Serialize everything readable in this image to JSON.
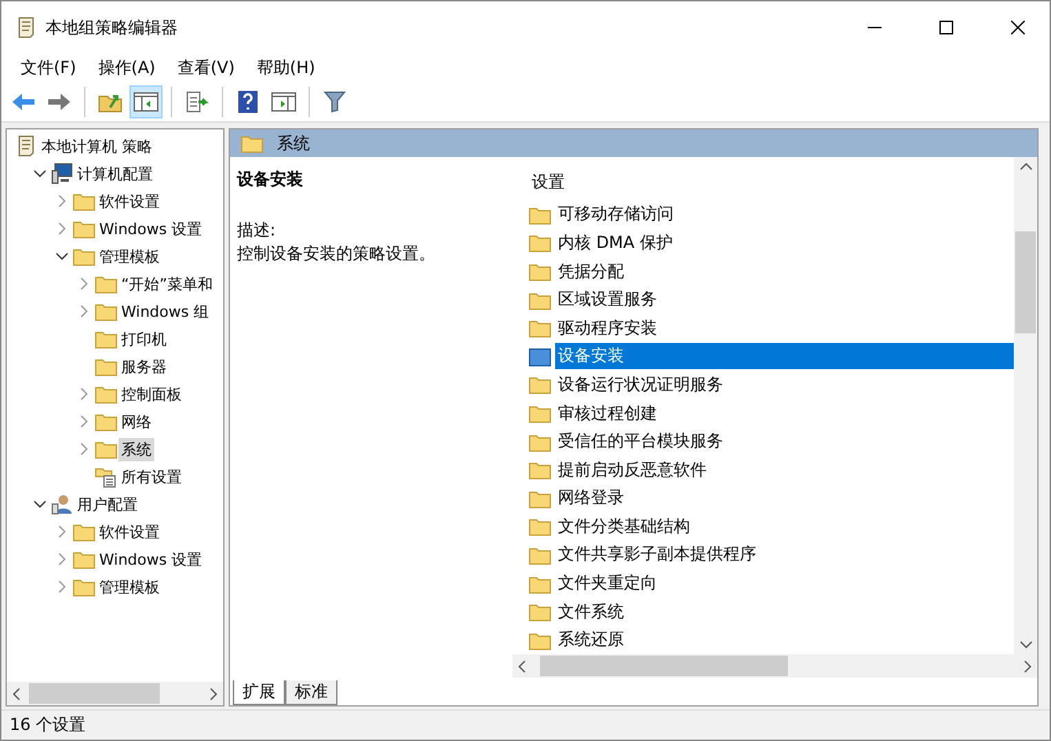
{
  "window": {
    "title": "本地组策略编辑器"
  },
  "menu": [
    "文件(F)",
    "操作(A)",
    "查看(V)",
    "帮助(H)"
  ],
  "toolbar": [
    [
      {
        "kind": "back",
        "pressed": false
      },
      {
        "kind": "forward",
        "pressed": false
      }
    ],
    [
      {
        "kind": "up",
        "pressed": false
      },
      {
        "kind": "tree",
        "pressed": true
      }
    ],
    [
      {
        "kind": "export",
        "pressed": false
      }
    ],
    [
      {
        "kind": "help",
        "pressed": false
      },
      {
        "kind": "panel",
        "pressed": false
      }
    ],
    [
      {
        "kind": "filter",
        "pressed": false
      }
    ]
  ],
  "tree": {
    "label": "本地计算机 策略",
    "kind": "policy",
    "selected": false,
    "children": [
      {
        "label": "计算机配置",
        "kind": "computer",
        "expandable": true,
        "expanded": true,
        "selected": false,
        "children": [
          {
            "label": "软件设置",
            "kind": "folder",
            "expandable": true,
            "expanded": false,
            "selected": false
          },
          {
            "label": "Windows 设置",
            "kind": "folder",
            "expandable": true,
            "expanded": false,
            "selected": false
          },
          {
            "label": "管理模板",
            "kind": "folder",
            "expandable": true,
            "expanded": true,
            "selected": false,
            "children": [
              {
                "label": "“开始”菜单和",
                "kind": "folder",
                "expandable": true,
                "expanded": false,
                "selected": false
              },
              {
                "label": "Windows 组",
                "kind": "folder",
                "expandable": true,
                "expanded": false,
                "selected": false
              },
              {
                "label": "打印机",
                "kind": "folder",
                "expandable": false,
                "selected": false
              },
              {
                "label": "服务器",
                "kind": "folder",
                "expandable": false,
                "selected": false
              },
              {
                "label": "控制面板",
                "kind": "folder",
                "expandable": true,
                "expanded": false,
                "selected": false
              },
              {
                "label": "网络",
                "kind": "folder",
                "expandable": true,
                "expanded": false,
                "selected": false
              },
              {
                "label": "系统",
                "kind": "folder",
                "expandable": true,
                "expanded": false,
                "selected": true
              },
              {
                "label": "所有设置",
                "kind": "settings",
                "expandable": false,
                "selected": false
              }
            ]
          }
        ]
      },
      {
        "label": "用户配置",
        "kind": "user",
        "expandable": true,
        "expanded": true,
        "selected": false,
        "children": [
          {
            "label": "软件设置",
            "kind": "folder",
            "expandable": true,
            "expanded": false,
            "selected": false
          },
          {
            "label": "Windows 设置",
            "kind": "folder",
            "expandable": true,
            "expanded": false,
            "selected": false
          },
          {
            "label": "管理模板",
            "kind": "folder",
            "expandable": true,
            "expanded": false,
            "selected": false
          }
        ]
      }
    ]
  },
  "pane_header": "系统",
  "details": {
    "title": "设备安装",
    "description_label": "描述:",
    "description": "控制设备安装的策略设置。"
  },
  "list": {
    "column": "设置",
    "items": [
      {
        "label": "可移动存储访问",
        "selected": false
      },
      {
        "label": "内核 DMA 保护",
        "selected": false
      },
      {
        "label": "凭据分配",
        "selected": false
      },
      {
        "label": "区域设置服务",
        "selected": false
      },
      {
        "label": "驱动程序安装",
        "selected": false
      },
      {
        "label": "设备安装",
        "selected": true
      },
      {
        "label": "设备运行状况证明服务",
        "selected": false
      },
      {
        "label": "审核过程创建",
        "selected": false
      },
      {
        "label": "受信任的平台模块服务",
        "selected": false
      },
      {
        "label": "提前启动反恶意软件",
        "selected": false
      },
      {
        "label": "网络登录",
        "selected": false
      },
      {
        "label": "文件分类基础结构",
        "selected": false
      },
      {
        "label": "文件共享影子副本提供程序",
        "selected": false
      },
      {
        "label": "文件夹重定向",
        "selected": false
      },
      {
        "label": "文件系统",
        "selected": false
      },
      {
        "label": "系统还原",
        "selected": false
      }
    ]
  },
  "view_tabs": [
    {
      "label": "扩展",
      "selected": true
    },
    {
      "label": "标准",
      "selected": false
    }
  ],
  "status_bar": "16 个设置"
}
